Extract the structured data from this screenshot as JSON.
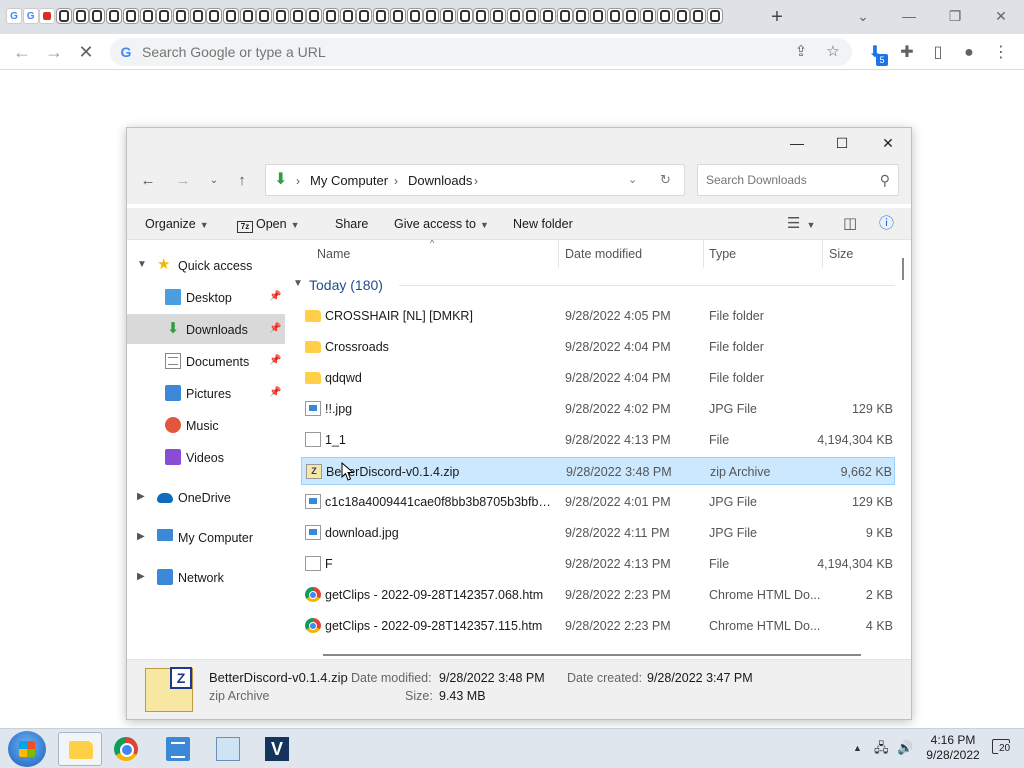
{
  "browser": {
    "tab_favicons": [
      "G",
      "G",
      "r",
      "p",
      "p",
      "p",
      "p",
      "p",
      "p",
      "p",
      "p",
      "p",
      "p",
      "p",
      "p",
      "p",
      "p",
      "p",
      "p",
      "p",
      "p",
      "p",
      "p",
      "p",
      "p",
      "p",
      "p",
      "p",
      "p",
      "p",
      "p",
      "p",
      "p",
      "p",
      "p",
      "p",
      "p",
      "p",
      "p",
      "p",
      "p",
      "p",
      "p"
    ],
    "new_tab_label": "+",
    "omnibox_placeholder": "Search Google or type a URL",
    "google_letter": "G",
    "extension_badge": "5"
  },
  "explorer": {
    "address": {
      "crumbs": [
        "My Computer",
        "Downloads"
      ]
    },
    "search_placeholder": "Search Downloads",
    "commands": {
      "organize": "Organize",
      "open": "Open",
      "share": "Share",
      "give_access": "Give access to",
      "new_folder": "New folder",
      "sevenzip_mark": "7z"
    },
    "nav": {
      "quick_access": "Quick access",
      "items": [
        "Desktop",
        "Downloads",
        "Documents",
        "Pictures",
        "Music",
        "Videos"
      ],
      "onedrive": "OneDrive",
      "my_computer": "My Computer",
      "network": "Network"
    },
    "columns": {
      "name": "Name",
      "date": "Date modified",
      "type": "Type",
      "size": "Size"
    },
    "group": "Today (180)",
    "files": [
      {
        "name": "CROSSHAIR [NL] [DMKR]",
        "date": "9/28/2022 4:05 PM",
        "type": "File folder",
        "size": "",
        "icon": "folder"
      },
      {
        "name": "Crossroads",
        "date": "9/28/2022 4:04 PM",
        "type": "File folder",
        "size": "",
        "icon": "folder"
      },
      {
        "name": "qdqwd",
        "date": "9/28/2022 4:04 PM",
        "type": "File folder",
        "size": "",
        "icon": "folder"
      },
      {
        "name": "!!.jpg",
        "date": "9/28/2022 4:02 PM",
        "type": "JPG File",
        "size": "129 KB",
        "icon": "jpg"
      },
      {
        "name": "1_1",
        "date": "9/28/2022 4:13 PM",
        "type": "File",
        "size": "4,194,304 KB",
        "icon": "file"
      },
      {
        "name": "BetterDiscord-v0.1.4.zip",
        "date": "9/28/2022 3:48 PM",
        "type": "zip Archive",
        "size": "9,662 KB",
        "icon": "zip"
      },
      {
        "name": "c1c18a4009441cae0f8bb3b8705b3bfb0f3b...",
        "date": "9/28/2022 4:01 PM",
        "type": "JPG File",
        "size": "129 KB",
        "icon": "jpg"
      },
      {
        "name": "download.jpg",
        "date": "9/28/2022 4:11 PM",
        "type": "JPG File",
        "size": "9 KB",
        "icon": "jpg"
      },
      {
        "name": "F",
        "date": "9/28/2022 4:13 PM",
        "type": "File",
        "size": "4,194,304 KB",
        "icon": "file"
      },
      {
        "name": "getClips - 2022-09-28T142357.068.htm",
        "date": "9/28/2022 2:23 PM",
        "type": "Chrome HTML Do...",
        "size": "2 KB",
        "icon": "chrome"
      },
      {
        "name": "getClips - 2022-09-28T142357.115.htm",
        "date": "9/28/2022 2:23 PM",
        "type": "Chrome HTML Do...",
        "size": "4 KB",
        "icon": "chrome"
      }
    ],
    "details": {
      "name": "BetterDiscord-v0.1.4.zip",
      "type": "zip Archive",
      "modified_label": "Date modified:",
      "modified": "9/28/2022 3:48 PM",
      "created_label": "Date created:",
      "created": "9/28/2022 3:47 PM",
      "size_label": "Size:",
      "size": "9.43 MB"
    }
  },
  "taskbar": {
    "time": "4:16 PM",
    "date": "9/28/2022",
    "notification_count": "20",
    "v_app_letter": "V"
  }
}
